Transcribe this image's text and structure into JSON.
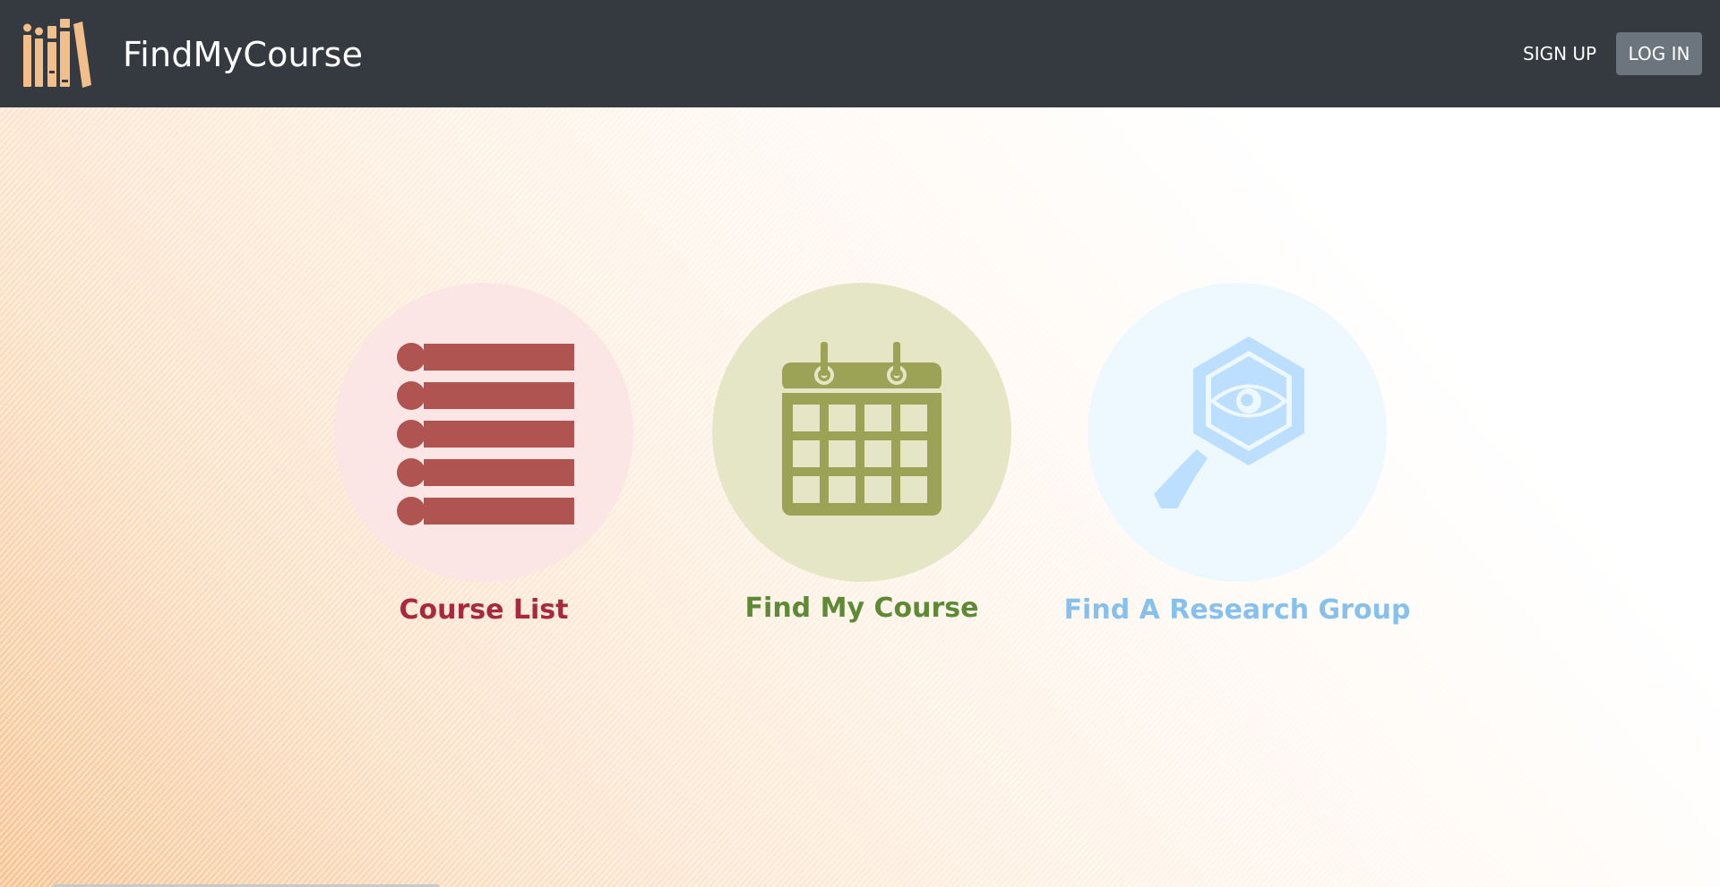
{
  "header": {
    "brand": "FindMyCourse",
    "logo_icon": "bookshelf-icon",
    "signup_label": "SIGN UP",
    "login_label": "LOG IN"
  },
  "features": [
    {
      "label": "Course List",
      "icon": "list-icon",
      "circle_color": "#fbe5e5",
      "icon_color": "#b05451",
      "label_color": "#a8283e"
    },
    {
      "label": "Find My Course",
      "icon": "calendar-icon",
      "circle_color": "#e5e6c5",
      "icon_color": "#9ca356",
      "label_color": "#5f8a35"
    },
    {
      "label": "Find A Research Group",
      "icon": "magnifier-eye-icon",
      "circle_color": "#eef8ff",
      "icon_color": "#bcdfff",
      "label_color": "#86c0ec"
    }
  ],
  "colors": {
    "navbar": "#343a40",
    "login_button": "#6c757d",
    "logo": "#f2be89"
  }
}
